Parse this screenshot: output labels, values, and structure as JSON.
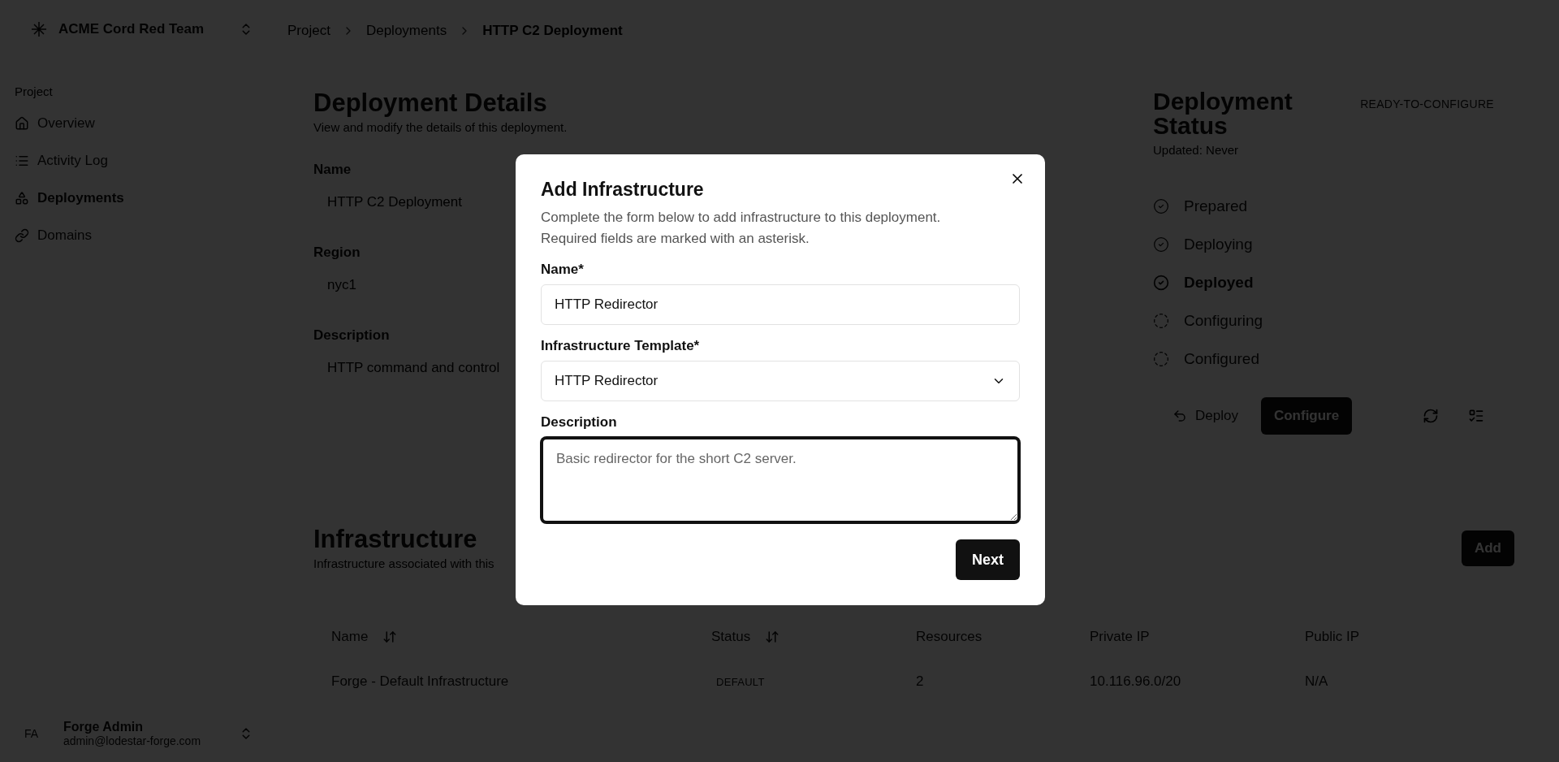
{
  "team": {
    "name": "ACME Cord Red Team"
  },
  "sidebar": {
    "section": "Project",
    "items": [
      {
        "label": "Overview",
        "selected": false
      },
      {
        "label": "Activity Log",
        "selected": false
      },
      {
        "label": "Deployments",
        "selected": true
      },
      {
        "label": "Domains",
        "selected": false
      }
    ]
  },
  "user": {
    "initials": "FA",
    "name": "Forge Admin",
    "email": "admin@lodestar-forge.com"
  },
  "breadcrumbs": [
    "Project",
    "Deployments",
    "HTTP C2 Deployment"
  ],
  "details": {
    "title": "Deployment Details",
    "subtitle": "View and modify the details of this deployment.",
    "fields": [
      {
        "label": "Name",
        "value": "HTTP C2 Deployment",
        "kind": "input"
      },
      {
        "label": "Region",
        "value": "nyc1",
        "kind": "input"
      },
      {
        "label": "Description",
        "value": "HTTP command and control",
        "kind": "textarea"
      }
    ]
  },
  "status": {
    "title": "Deployment Status",
    "badge": "READY-TO-CONFIGURE",
    "updated": "Updated: Never",
    "steps": [
      {
        "label": "Prepared",
        "complete": true,
        "current": false
      },
      {
        "label": "Deploying",
        "complete": true,
        "current": false
      },
      {
        "label": "Deployed",
        "complete": true,
        "current": true
      },
      {
        "label": "Configuring",
        "complete": false,
        "current": false
      },
      {
        "label": "Configured",
        "complete": false,
        "current": false
      }
    ],
    "actions": [
      {
        "label": "Deploy",
        "kind": "ghost"
      },
      {
        "label": "Configure",
        "kind": "primary"
      }
    ]
  },
  "infrastructure": {
    "title": "Infrastructure",
    "subtitle": "Infrastructure associated with this",
    "add_button": "Add",
    "columns": [
      {
        "label": "Name",
        "sortable": true,
        "kind": "text"
      },
      {
        "label": "Status",
        "sortable": true,
        "kind": "badge"
      },
      {
        "label": "Resources",
        "sortable": false,
        "kind": "text"
      },
      {
        "label": "Private IP",
        "sortable": false,
        "kind": "text"
      },
      {
        "label": "Public IP",
        "sortable": false,
        "kind": "text"
      }
    ],
    "rows": [
      {
        "cells": [
          "Forge - Default Infrastructure",
          "DEFAULT",
          "2",
          "10.116.96.0/20",
          "N/A"
        ]
      }
    ]
  },
  "modal": {
    "title": "Add Infrastructure",
    "description": "Complete the form below to add infrastructure to this deployment. Required fields are marked with an asterisk.",
    "fields": [
      {
        "label": "Name*",
        "value": "HTTP Redirector",
        "kind": "input",
        "focused": false
      },
      {
        "label": "Infrastructure Template*",
        "value": "HTTP Redirector",
        "kind": "select",
        "focused": false
      },
      {
        "label": "Description",
        "placeholder": "Basic redirector for the short C2 server.",
        "kind": "textarea",
        "focused": true
      }
    ],
    "button": "Next"
  }
}
